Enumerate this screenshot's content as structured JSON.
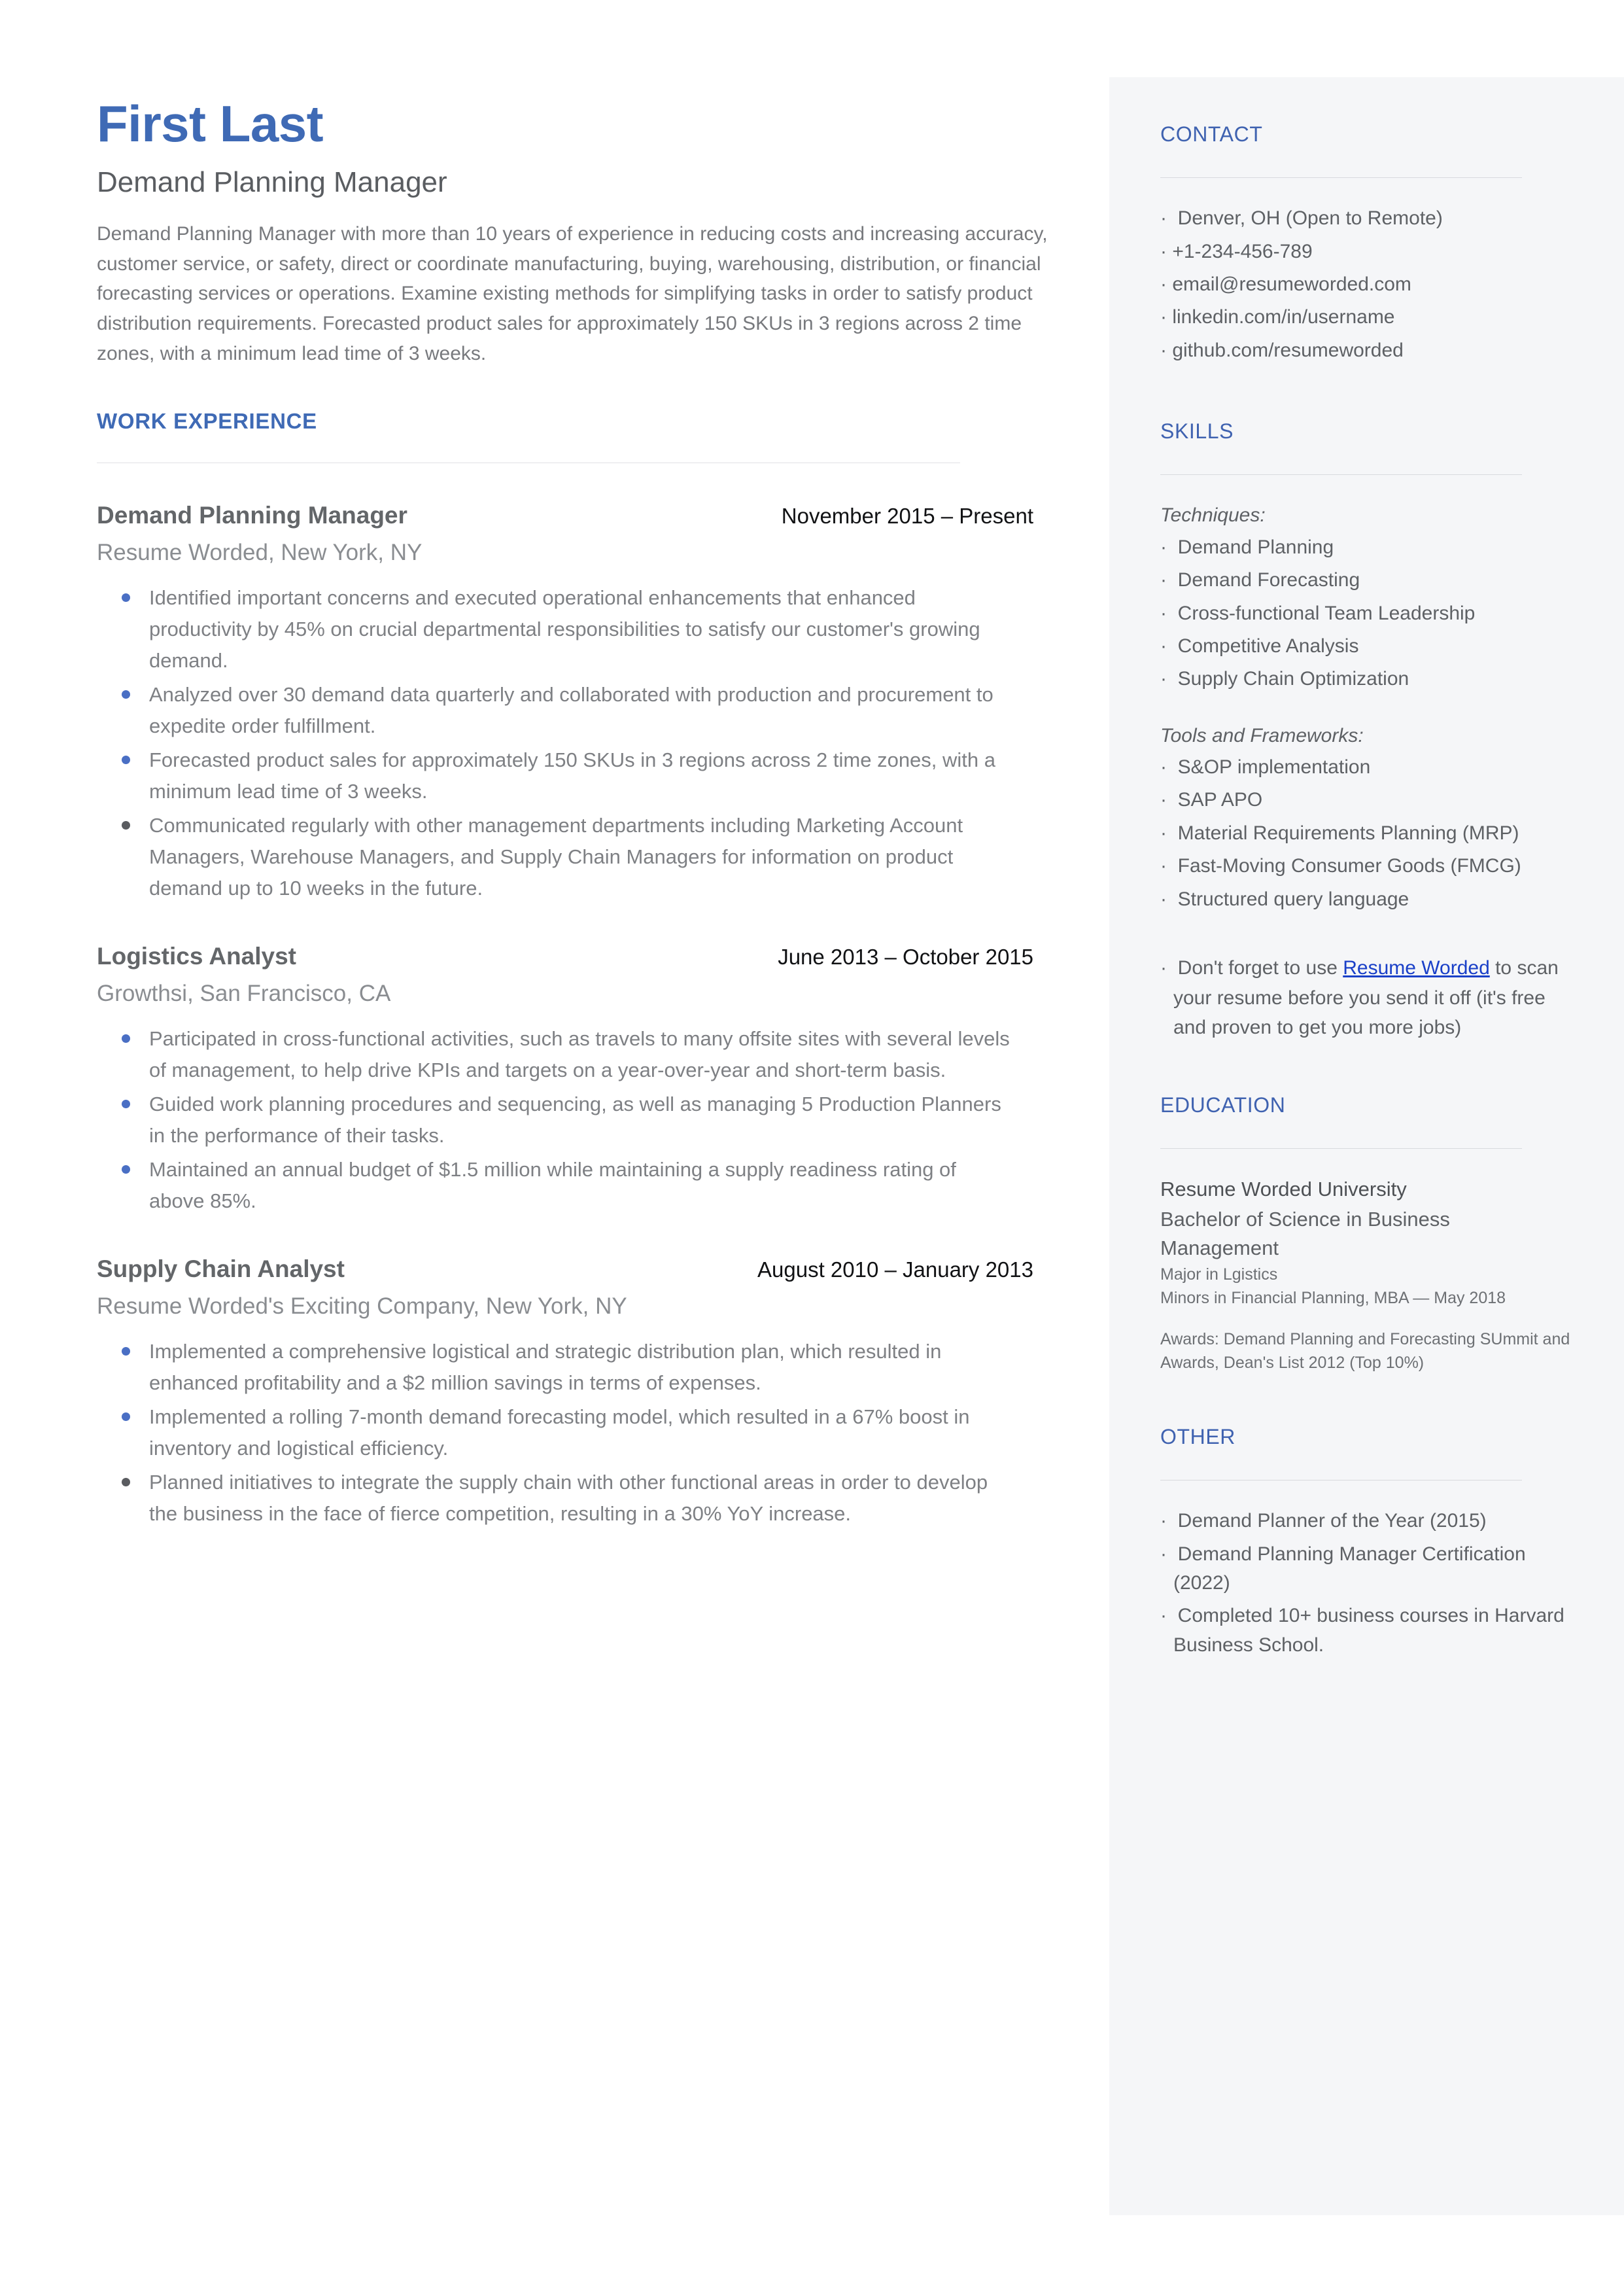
{
  "header": {
    "name": "First Last",
    "headline": "Demand Planning Manager",
    "summary": "Demand Planning Manager  with more than 10  years of experience in reducing costs and increasing accuracy, customer service, or safety, direct or coordinate manufacturing, buying, warehousing, distribution, or financial forecasting services or operations. Examine existing methods for simplifying tasks in order to satisfy product distribution requirements. Forecasted product sales for approximately 150 SKUs in 3 regions across 2 time zones, with a minimum lead time of 3 weeks."
  },
  "work": {
    "section_title": "WORK EXPERIENCE",
    "jobs": [
      {
        "title": "Demand Planning Manager",
        "dates": "November 2015 – Present",
        "company": "Resume Worded, New York, NY",
        "bullets": [
          {
            "text": "Identified important concerns and executed operational enhancements that enhanced productivity by 45% on crucial departmental responsibilities to satisfy our customer's growing demand.",
            "dot": "blue"
          },
          {
            "text": "Analyzed over 30 demand data quarterly and collaborated with production and procurement to expedite order fulfillment.",
            "dot": "blue"
          },
          {
            "text": "Forecasted product sales for approximately 150 SKUs in 3 regions across 2 time zones, with a minimum lead time of 3 weeks.",
            "dot": "blue"
          },
          {
            "text": "Communicated regularly with other management departments including Marketing Account Managers, Warehouse Managers, and Supply Chain Managers for information on product demand up to 10 weeks in the future.",
            "dot": "gray"
          }
        ]
      },
      {
        "title": "Logistics Analyst",
        "dates": "June 2013 – October 2015",
        "company": "Growthsi, San Francisco, CA",
        "bullets": [
          {
            "text": "Participated in cross-functional activities, such as travels to many offsite sites with several levels of management, to help drive KPIs and targets on a year-over-year and short-term basis.",
            "dot": "blue"
          },
          {
            "text": "Guided work planning procedures and sequencing, as well as managing 5 Production Planners in the performance of their tasks.",
            "dot": "blue"
          },
          {
            "text": "Maintained an annual budget of $1.5 million while maintaining a supply readiness rating of above 85%.",
            "dot": "blue"
          }
        ]
      },
      {
        "title": "Supply Chain Analyst",
        "dates": "August 2010 – January 2013",
        "company": "Resume Worded's Exciting Company, New York, NY",
        "bullets": [
          {
            "text": "Implemented a comprehensive logistical and strategic distribution plan, which resulted in enhanced profitability and a $2 million savings in terms of expenses.",
            "dot": "blue"
          },
          {
            "text": "Implemented a rolling 7-month demand forecasting model, which resulted in a 67% boost in inventory and logistical efficiency.",
            "dot": "blue"
          },
          {
            "text": "Planned initiatives to integrate the supply chain with other functional areas in order to develop the business in the face of fierce competition, resulting in a 30% YoY increase.",
            "dot": "gray"
          }
        ]
      }
    ]
  },
  "sidebar": {
    "contact": {
      "title": "CONTACT",
      "items": [
        "Denver, OH (Open to Remote)",
        "+1-234-456-789",
        "email@resumeworded.com",
        "linkedin.com/in/username",
        "github.com/resumeworded"
      ]
    },
    "skills": {
      "title": "SKILLS",
      "groups": [
        {
          "label": "Techniques:",
          "items": [
            "Demand Planning",
            "Demand Forecasting",
            "Cross-functional Team Leadership",
            "Competitive Analysis",
            "Supply Chain Optimization"
          ]
        },
        {
          "label": "Tools and Frameworks:",
          "items": [
            "S&OP implementation",
            "SAP APO",
            "Material Requirements Planning (MRP)",
            "Fast-Moving Consumer Goods (FMCG)",
            "Structured query language"
          ]
        }
      ],
      "promo": {
        "before": "Don't forget to use ",
        "link": "Resume Worded",
        "after": " to scan your resume before you send it off (it's free and proven to get you more jobs)"
      }
    },
    "education": {
      "title": "EDUCATION",
      "school": "Resume Worded University",
      "degree": "Bachelor of Science in Business Management",
      "major": "Major in Lgistics",
      "minors": "Minors in Financial Planning, MBA — May 2018",
      "awards": "Awards: Demand Planning and Forecasting SUmmit and Awards, Dean's List 2012 (Top 10%)"
    },
    "other": {
      "title": "OTHER",
      "items": [
        "Demand Planner of the Year (2015)",
        "Demand Planning Manager Certification (2022)",
        "Completed 10+ business courses in Harvard Business School."
      ]
    }
  },
  "colors": {
    "accent_blue": "#3f6ab5",
    "link_blue": "#1a40c8",
    "sidebar_bg": "#f5f6f8",
    "body_text": "#7e8084"
  }
}
